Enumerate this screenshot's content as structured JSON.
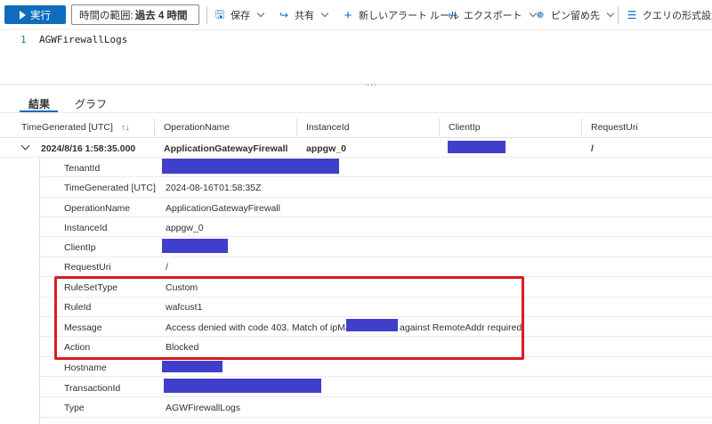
{
  "toolbar": {
    "run_label": "実行",
    "time_range_label": "時間の範囲:",
    "time_range_value": "過去 4 時間",
    "save_label": "保存",
    "share_label": "共有",
    "new_alert_label": "新しいアラート ルール",
    "export_label": "エクスポート",
    "pin_label": "ピン留め先",
    "format_label": "クエリの形式設定"
  },
  "editor": {
    "line_number": "1",
    "code": "AGWFirewallLogs",
    "splitter_glyph": "···"
  },
  "tabs": [
    {
      "label": "結果",
      "active": true
    },
    {
      "label": "グラフ",
      "active": false
    }
  ],
  "columns": [
    {
      "label": "TimeGenerated [UTC]",
      "sort_icon": "↑↓"
    },
    {
      "label": "OperationName"
    },
    {
      "label": "InstanceId"
    },
    {
      "label": "ClientIp"
    },
    {
      "label": "RequestUri"
    }
  ],
  "main_row": {
    "time": "2024/8/16 1:58:35.000",
    "operation": "ApplicationGatewayFirewall",
    "instance": "appgw_0",
    "request_uri": "/"
  },
  "details": [
    {
      "key": "TenantId",
      "value": ""
    },
    {
      "key": "TimeGenerated [UTC]",
      "value": "2024-08-16T01:58:35Z"
    },
    {
      "key": "OperationName",
      "value": "ApplicationGatewayFirewall"
    },
    {
      "key": "InstanceId",
      "value": "appgw_0"
    },
    {
      "key": "ClientIp",
      "value": ""
    },
    {
      "key": "RequestUri",
      "value": "/"
    },
    {
      "key": "RuleSetType",
      "value": "Custom"
    },
    {
      "key": "RuleId",
      "value": "wafcust1"
    },
    {
      "key": "Message",
      "value_prefix": "Access denied with code 403. Match of ipMatch",
      "value_suffix": "against RemoteAddr required."
    },
    {
      "key": "Action",
      "value": "Blocked"
    },
    {
      "key": "Hostname",
      "value": ""
    },
    {
      "key": "TransactionId",
      "value": ""
    },
    {
      "key": "Type",
      "value": "AGWFirewallLogs"
    }
  ],
  "colors": {
    "accent": "#0f6cbd",
    "redaction": "#3f3fcc",
    "highlight_border": "#d81c24"
  }
}
